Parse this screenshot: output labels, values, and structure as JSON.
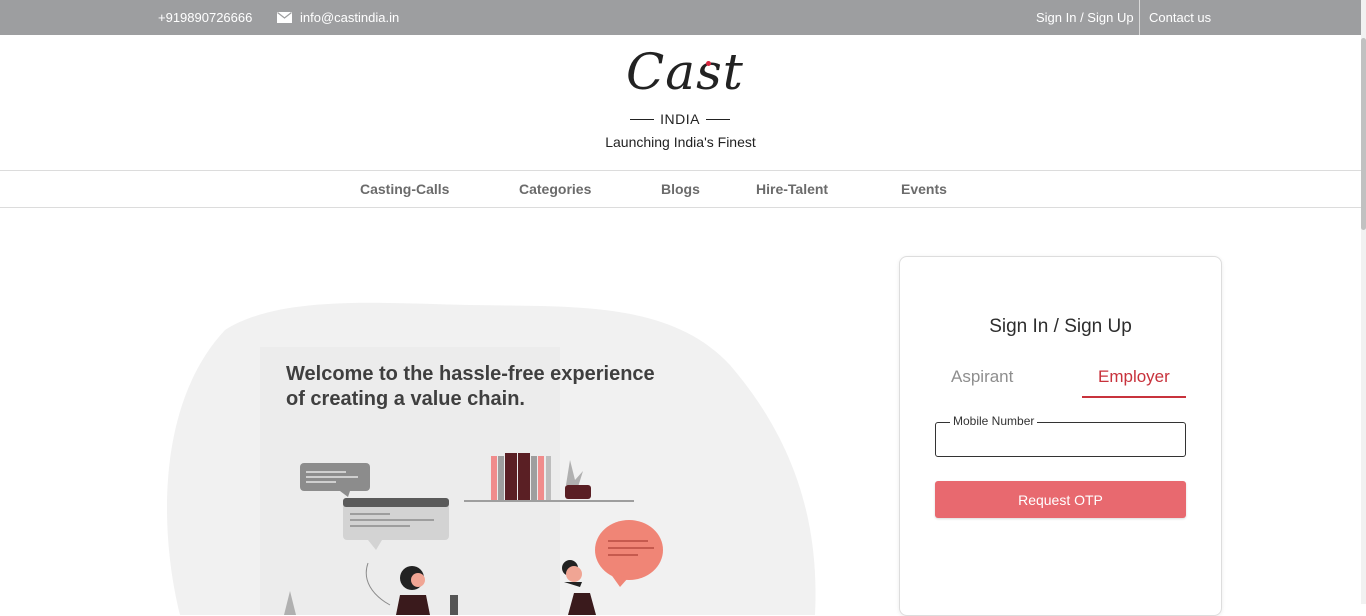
{
  "topbar": {
    "phone": "+919890726666",
    "email": "info@castindia.in",
    "signin": "Sign In / Sign Up",
    "contact": "Contact us"
  },
  "logo": {
    "script": "Cast",
    "sub": "INDIA",
    "accent_color": "#d7263d"
  },
  "tagline": "Launching India's Finest",
  "nav": {
    "items": [
      "Casting-Calls",
      "Categories",
      "Blogs",
      "Hire-Talent",
      "Events"
    ]
  },
  "hero": {
    "title_line1": "Welcome to the hassle-free experience",
    "title_line2": "of creating a value chain."
  },
  "card": {
    "title": "Sign In / Sign Up",
    "tabs": [
      "Aspirant",
      "Employer"
    ],
    "active_tab": "Employer",
    "field_label": "Mobile Number",
    "field_value": "",
    "button": "Request OTP",
    "accent_color": "#c8323c",
    "button_color": "#e8696f"
  },
  "colors": {
    "topbar_bg": "#9d9ea0",
    "nav_text": "#6b6b6b"
  }
}
